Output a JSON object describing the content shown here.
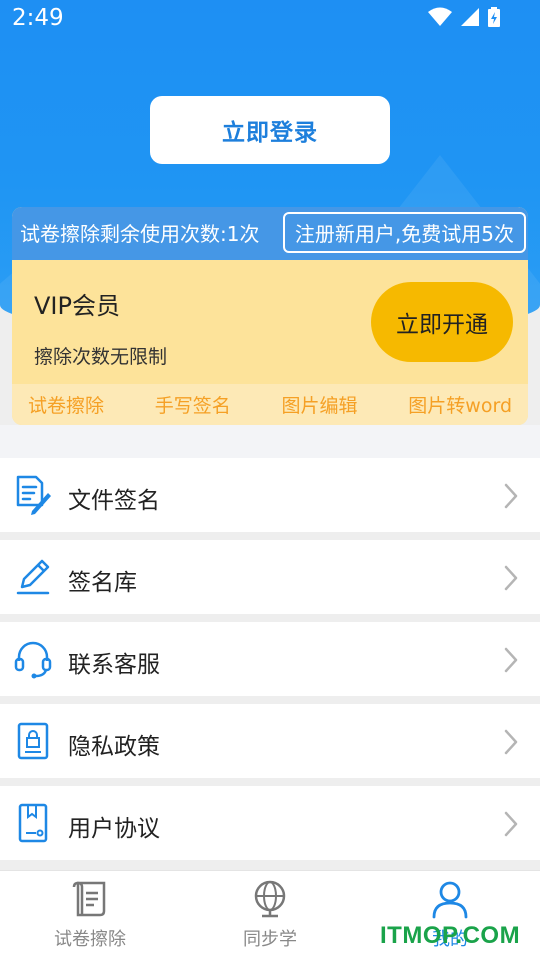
{
  "status_bar": {
    "time": "2:49"
  },
  "header": {
    "login_label": "立即登录"
  },
  "quota": {
    "text": "试卷擦除剩余使用次数:1次",
    "register_label": "注册新用户,免费试用5次"
  },
  "vip": {
    "title": "VIP会员",
    "subtitle": "擦除次数无限制",
    "open_label": "立即开通",
    "features": [
      "试卷擦除",
      "手写签名",
      "图片编辑",
      "图片转word"
    ]
  },
  "menu": {
    "items": [
      {
        "label": "文件签名",
        "icon": "document-sign-icon"
      },
      {
        "label": "签名库",
        "icon": "pen-icon"
      },
      {
        "label": "联系客服",
        "icon": "headset-icon"
      },
      {
        "label": "隐私政策",
        "icon": "lock-document-icon"
      },
      {
        "label": "用户协议",
        "icon": "agreement-icon"
      }
    ]
  },
  "bottom_nav": {
    "items": [
      {
        "label": "试卷擦除",
        "icon": "scroll-icon"
      },
      {
        "label": "同步学",
        "icon": "globe-icon"
      },
      {
        "label": "我的",
        "icon": "user-icon",
        "active": true
      }
    ]
  },
  "watermark": "ITMOP.COM",
  "colors": {
    "primary": "#1e8ff3",
    "vip_bg": "#fde39a",
    "vip_button": "#f6b900",
    "feature_text": "#f5a025",
    "icon_blue": "#1e88e5"
  }
}
